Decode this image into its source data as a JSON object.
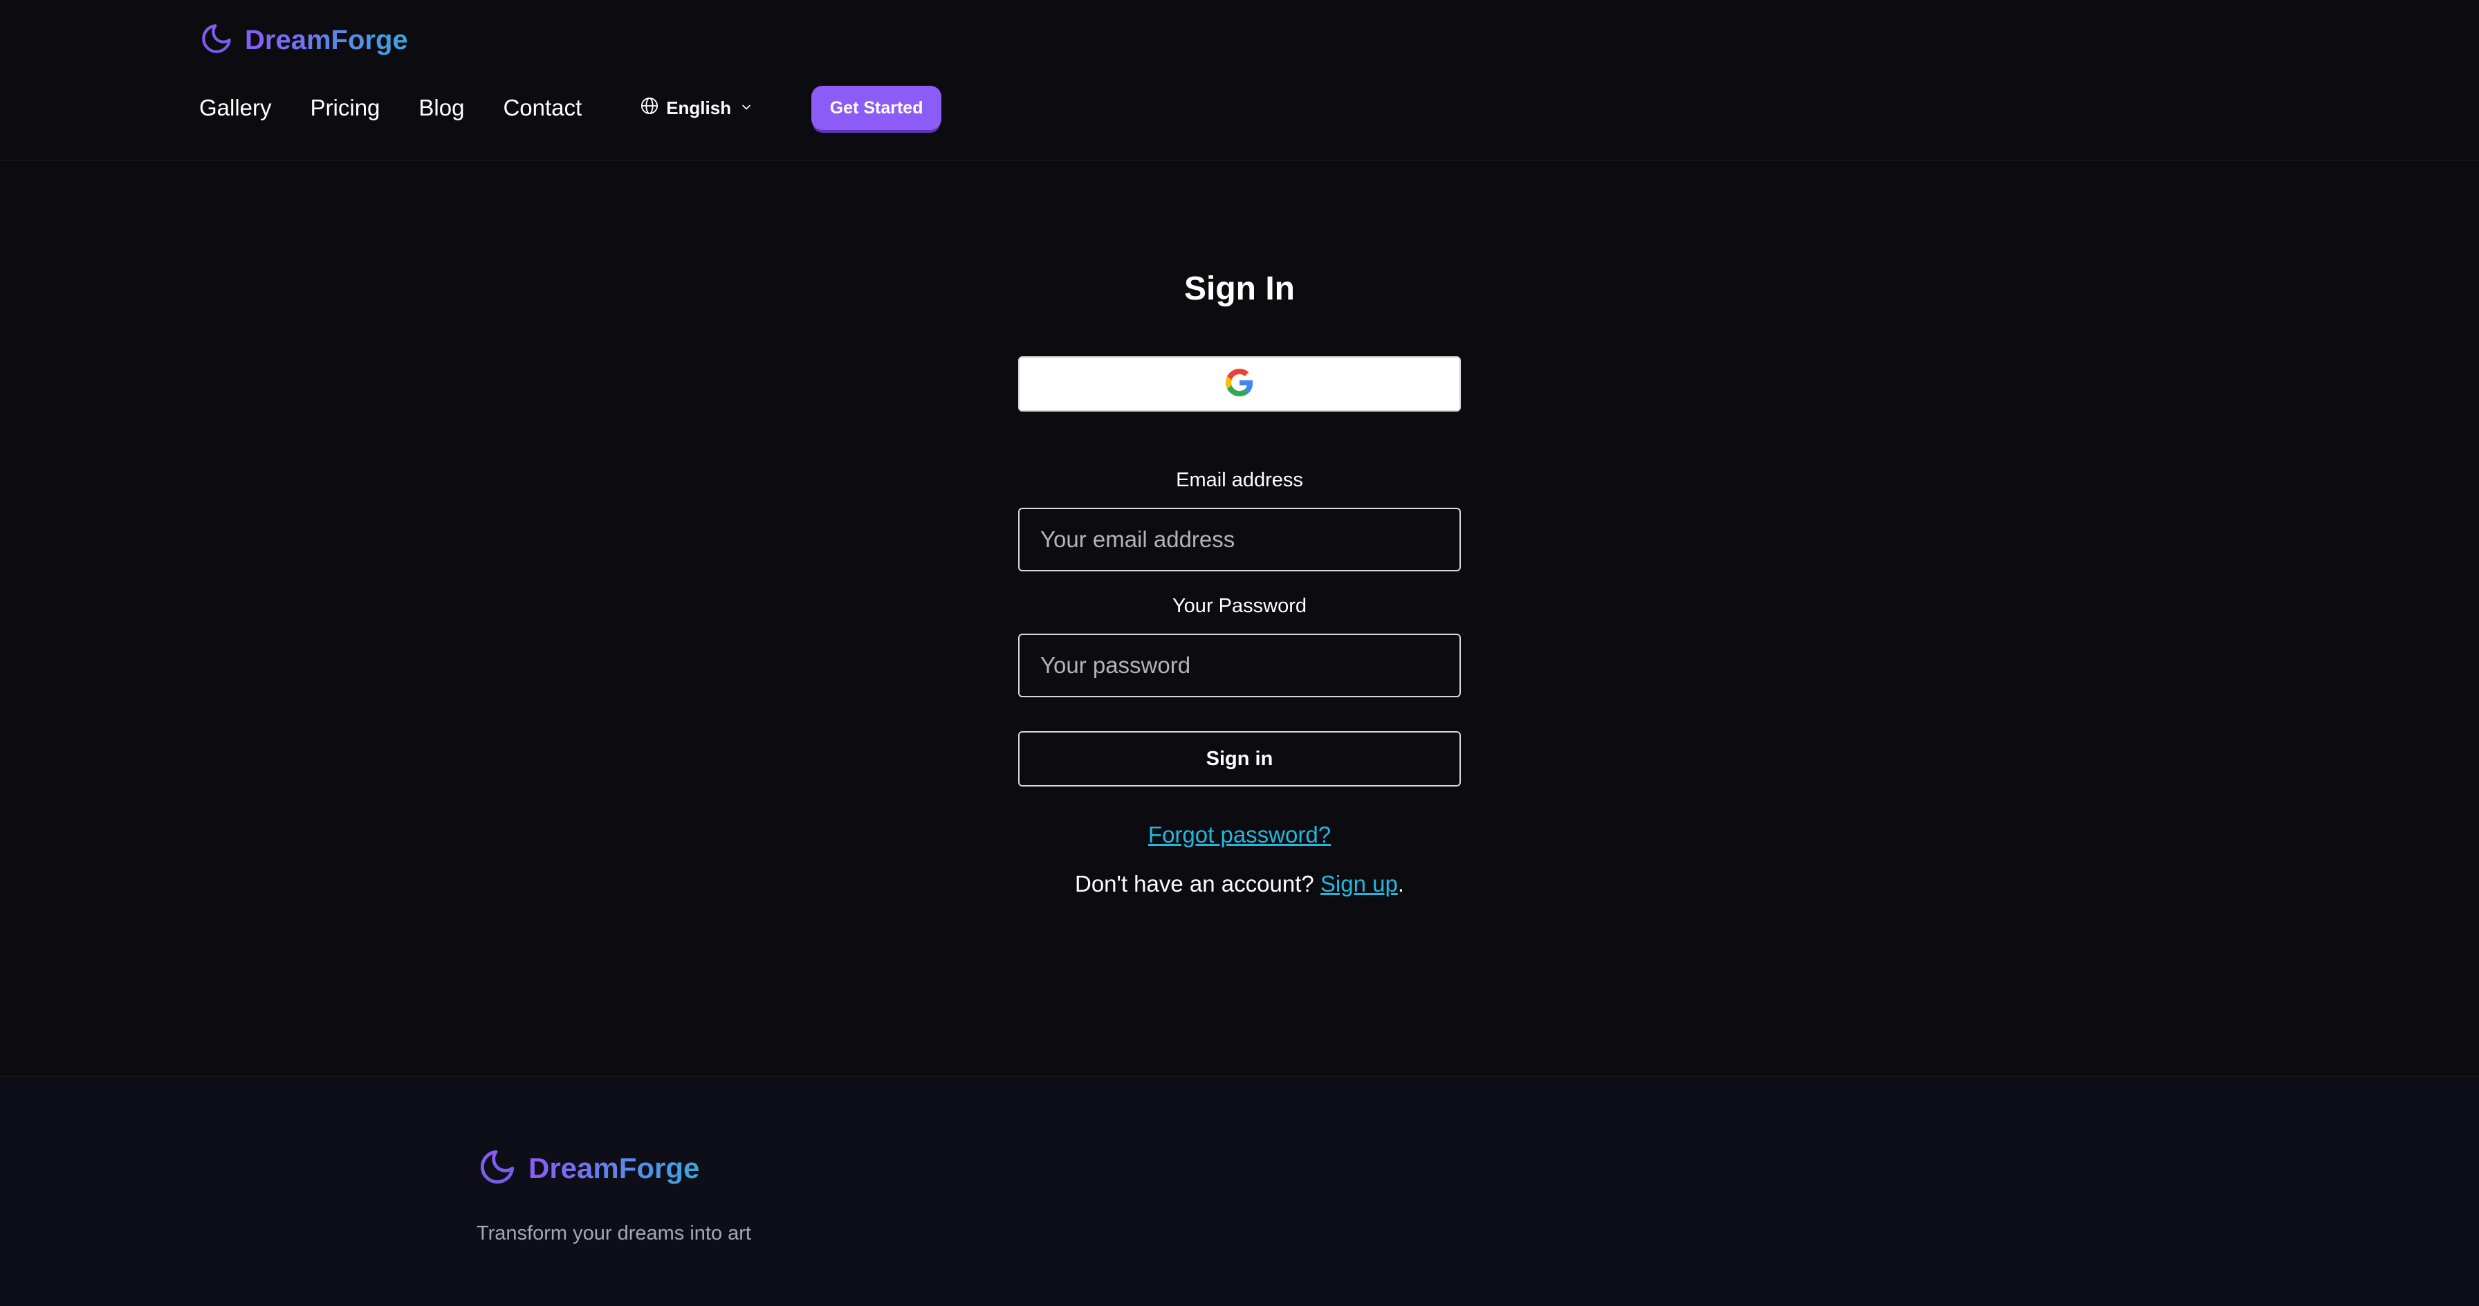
{
  "brand": {
    "name": "DreamForge",
    "gradient_start": "#8b5cf6",
    "gradient_end": "#3ba7dc",
    "icon": "moon-icon"
  },
  "nav": {
    "items": [
      {
        "label": "Gallery"
      },
      {
        "label": "Pricing"
      },
      {
        "label": "Blog"
      },
      {
        "label": "Contact"
      }
    ],
    "language": {
      "label": "English",
      "icon": "globe-icon"
    },
    "cta": {
      "label": "Get Started",
      "color": "#8b5cf6"
    }
  },
  "signin": {
    "title": "Sign In",
    "google_button_icon": "google-icon",
    "email": {
      "label": "Email address",
      "placeholder": "Your email address",
      "value": ""
    },
    "password": {
      "label": "Your Password",
      "placeholder": "Your password",
      "value": ""
    },
    "submit_label": "Sign in",
    "forgot_label": "Forgot password?",
    "signup_prompt": "Don't have an account? ",
    "signup_link": "Sign up",
    "signup_suffix": ".",
    "link_color": "#22b8e0"
  },
  "footer": {
    "brand_name": "DreamForge",
    "tagline": "Transform your dreams into art"
  }
}
